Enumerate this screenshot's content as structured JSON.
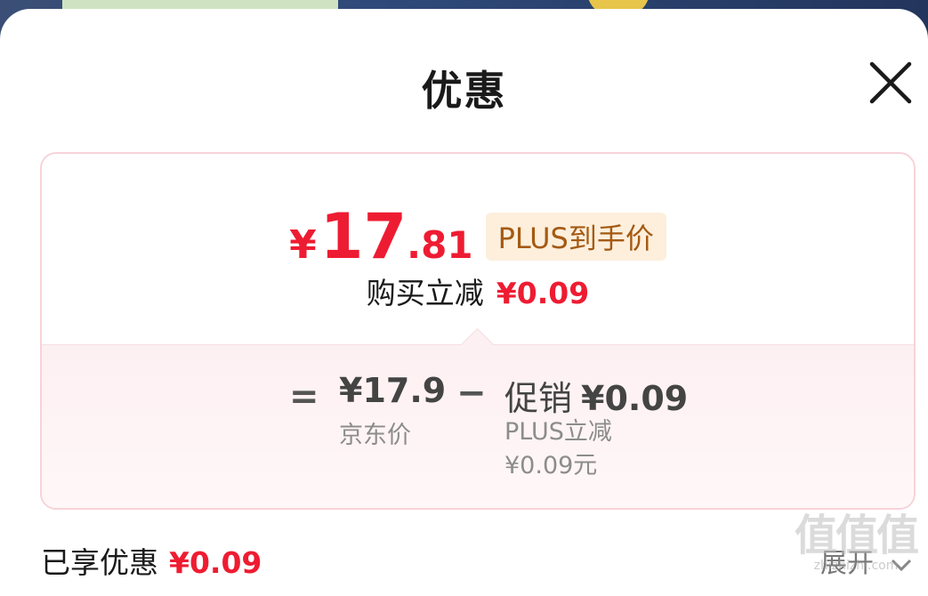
{
  "sheet": {
    "title": "优惠",
    "close_icon": "close-icon"
  },
  "summary": {
    "currency": "¥",
    "price_integer": "17",
    "price_decimal": ".81",
    "badge": "PLUS到手价",
    "reduce_label": "购买立减",
    "reduce_amount": "¥0.09"
  },
  "breakdown": {
    "equals": "=",
    "jd_price": "¥17.9",
    "jd_label": "京东价",
    "minus": "−",
    "promo_label": "促销",
    "promo_amount": "¥0.09",
    "promo_sub_1": "PLUS立减",
    "promo_sub_2": "¥0.09元"
  },
  "footer": {
    "enjoyed_label": "已享优惠",
    "enjoyed_amount": "¥0.09",
    "expand_label": "展开",
    "expand_icon": "chevron-down-icon"
  },
  "watermark": {
    "mark": "值值值",
    "site": "zhizhizhi.com"
  },
  "colors": {
    "accent_red": "#ee1c32",
    "badge_bg": "#fdefdc",
    "badge_text": "#a45a13",
    "card_border": "#f7d3da"
  }
}
